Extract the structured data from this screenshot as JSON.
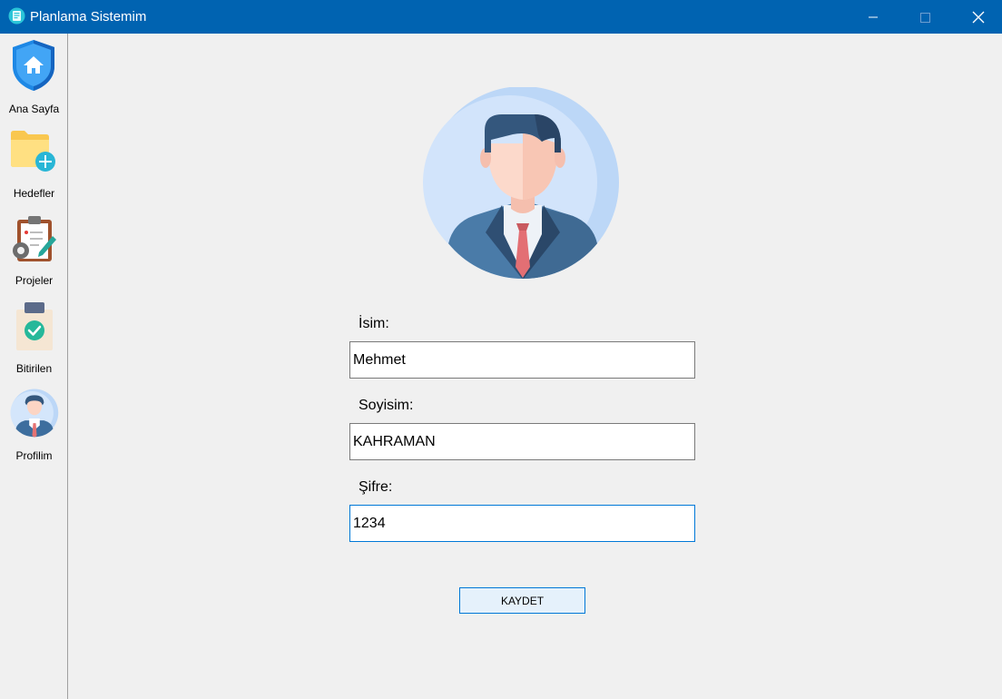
{
  "window": {
    "title": "Planlama Sistemim",
    "accent": "#0063b1"
  },
  "sidebar": {
    "items": [
      {
        "label": "Ana Sayfa",
        "icon": "home-shield-icon"
      },
      {
        "label": "Hedefler",
        "icon": "folder-add-icon"
      },
      {
        "label": "Projeler",
        "icon": "clipboard-gear-icon"
      },
      {
        "label": "Bitirilen",
        "icon": "clipboard-check-icon"
      },
      {
        "label": "Profilim",
        "icon": "avatar-icon"
      }
    ]
  },
  "profile": {
    "name_label": "İsim:",
    "name_value": "Mehmet",
    "surname_label": "Soyisim:",
    "surname_value": "KAHRAMAN",
    "password_label": "Şifre:",
    "password_value": "1234",
    "save_label": "KAYDET"
  }
}
